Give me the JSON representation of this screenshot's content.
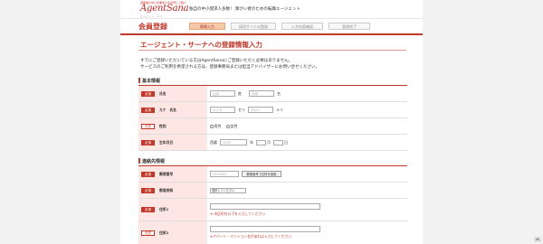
{
  "header": {
    "logo_small": "首都圏の中小企業求人を専門にご紹介",
    "logo_main": "AgentSana",
    "logo_sub": "エージェント・サーナ",
    "tagline": "独自の中小開求人多数！ 障がい者のための転職エージェント"
  },
  "title": "会員登録",
  "steps": [
    {
      "label": "情報入力",
      "active": true
    },
    {
      "label": "採用サイトの登録",
      "active": false
    },
    {
      "label": "入力内容確認",
      "active": false
    },
    {
      "label": "登録完了",
      "active": false
    }
  ],
  "heading": "エージェント・サーナへの登録情報入力",
  "notes": [
    "すでにご登録いただいている方はAgentSanaにご登録いただく必要はありません。",
    "サービスのご利用を希望される方は、登録事務局または担当アドバイザーにお問い合せください。"
  ],
  "badges": {
    "required": "必須",
    "optional": "任意"
  },
  "basic": {
    "section_title": "基本情報",
    "name": {
      "label": "氏名",
      "last_placeholder": "山田",
      "last_suffix": "姓",
      "first_placeholder": "太郎",
      "first_suffix": "名"
    },
    "kana": {
      "label": "カナ　氏名",
      "last_placeholder": "ヤマダ",
      "last_suffix": "セイ",
      "first_placeholder": "タロウ",
      "first_suffix": "メイ"
    },
    "gender": {
      "label": "性別",
      "options": [
        "男性",
        "女性"
      ]
    },
    "birth": {
      "label": "生年月日",
      "era_prefix": "西暦",
      "year_placeholder": "2000",
      "year_suffix": "年",
      "month_value": "-",
      "month_suffix": "月",
      "day_value": "-",
      "day_suffix": "日"
    }
  },
  "contact": {
    "section_title": "連絡先情報",
    "zip": {
      "label": "郵便番号",
      "placeholder": "0010001",
      "button": "郵便番号で住所を検索"
    },
    "pref": {
      "label": "都道府県",
      "select_value": "選択してください"
    },
    "addr1": {
      "label": "住所1",
      "error": "※ 市区町村以下を入力してください"
    },
    "addr2": {
      "label": "住所2",
      "error": "※アパート・マンション名があれば入力してください"
    }
  }
}
